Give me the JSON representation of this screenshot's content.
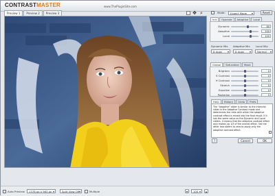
{
  "header": {
    "logo_prefix": "C",
    "logo_word": "ONTRAST",
    "logo_suffix": "MASTER",
    "site": "www.ThePluginSite.com"
  },
  "toolbar": {
    "mode_label": "Mode:",
    "mode_value": "Expert Mode",
    "reset_label": "Reset"
  },
  "preview_tabs": [
    "Preview 1",
    "Preview 2",
    "Preview 3"
  ],
  "panel1": {
    "tabs": [
      "Init",
      "Operate",
      "Adaptive",
      "Local"
    ],
    "sliders": [
      {
        "label": "Dynamic",
        "value": "80",
        "level": 0.6
      },
      {
        "label": "Adaptive",
        "value": "100",
        "level": 0.7
      },
      {
        "label": "Local",
        "value": "100",
        "level": 0.7
      }
    ],
    "dropdown_labels": [
      "Dynamic Mix",
      "Adaptive Mix",
      "Local Mix"
    ],
    "dropdown_values": [
      "8 Apps",
      "8 Apps",
      "Normal"
    ]
  },
  "panel2": {
    "tabs": [
      "Global",
      "Saturation",
      "Mask"
    ],
    "sliders": [
      {
        "label": "Brighten",
        "value": "0",
        "level": 0.5
      },
      {
        "label": "S Contrast",
        "value": "0",
        "level": 0.5
      },
      {
        "label": "H Contrast",
        "value": "0",
        "level": 0.5
      },
      {
        "label": "Stretch",
        "value": "0",
        "level": 0.5
      },
      {
        "label": "Equalize",
        "value": "0",
        "level": 0.5
      },
      {
        "label": "Posterize",
        "value": "0",
        "level": 0.5
      }
    ]
  },
  "help": {
    "tabs": [
      "Help",
      "History",
      "Undo",
      "Prefs"
    ],
    "text": "The \"Adaptive\" slider is similar to the Intensity slider in the Adaptive Contrast mode and determines the ratio with which the adaptive contrast effect is mixed into the final result. If it has the same value as the Dynamic and Local sliders, it means that the adaptive contrast effect only makes up 1/3 of the overall effect. Set the other two sliders to zero to apply only the adaptive contrast effect."
  },
  "dialog": {
    "help_button": "?",
    "cancel_button": "Cancel",
    "ok_button": "OK"
  },
  "footer": {
    "auto_preview_label": "Auto Preview",
    "size_value": "1376 px x 963 px",
    "split_view_value": "Split View Off",
    "multiple_label": "Multiple",
    "zoom_value": "100"
  },
  "colors": {
    "accent": "#e07a10",
    "window_bg": "#e4e8ec",
    "jacket": "#f2cf1a",
    "graffiti_blue": "#3d5b86"
  }
}
